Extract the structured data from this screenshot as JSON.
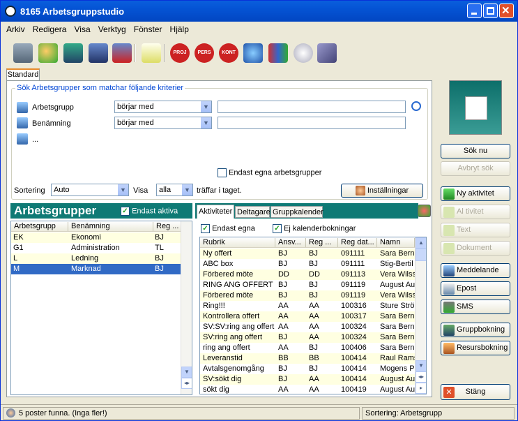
{
  "window": {
    "title": "8165 Arbetsgruppstudio"
  },
  "menu": [
    "Arkiv",
    "Redigera",
    "Visa",
    "Verktyg",
    "Fönster",
    "Hjälp"
  ],
  "toolbar": {
    "icons": [
      "copy-icon",
      "add-user-icon",
      "add-group-icon",
      "save-icon",
      "delete-icon",
      "checklist-icon",
      "proj-icon",
      "pers-icon",
      "kont-icon",
      "sync-icon",
      "books-icon",
      "stopwatch-icon",
      "notebook-icon"
    ],
    "labels": {
      "proj": "PROJ",
      "pers": "PERS",
      "kont": "KONT"
    }
  },
  "tab": "Standard",
  "search": {
    "legend": "Sök  Arbetsgrupper som matchar följande kriterier",
    "rows": [
      {
        "label": "Arbetsgrupp",
        "operator": "börjar med",
        "value": ""
      },
      {
        "label": "Benämning",
        "operator": "börjar med",
        "value": ""
      }
    ],
    "more": "...",
    "own_only": "Endast egna arbetsgrupper",
    "sort_label": "Sortering",
    "sort_value": "Auto",
    "show_label": "Visa",
    "show_value": "alla",
    "hits_suffix": "träffar i taget.",
    "settings_button": "Inställningar"
  },
  "groups": {
    "title": "Arbetsgrupper",
    "active_only": "Endast aktiva",
    "columns": [
      "Arbetsgrupp",
      "Benämning",
      "Reg ..."
    ],
    "rows": [
      {
        "code": "EK",
        "name": "Ekonomi",
        "reg": "BJ"
      },
      {
        "code": "G1",
        "name": "Administration",
        "reg": "TL"
      },
      {
        "code": "L",
        "name": "Ledning",
        "reg": "BJ"
      },
      {
        "code": "M",
        "name": "Marknad",
        "reg": "BJ"
      }
    ],
    "selected": 3
  },
  "activities": {
    "tabs": [
      "Aktiviteter",
      "Deltagare",
      "Gruppkalender"
    ],
    "own_only": "Endast egna",
    "no_calendar": "Ej kalenderbokningar",
    "columns": [
      "Rubrik",
      "Ansv...",
      "Reg ...",
      "Reg dat...",
      "Namn"
    ],
    "rows": [
      [
        "Ny offert",
        "BJ",
        "BJ",
        "091111",
        "Sara Bernh"
      ],
      [
        "ABC box",
        "BJ",
        "BJ",
        "091111",
        "Stig-Bertil A"
      ],
      [
        "Förbered möte",
        "DD",
        "DD",
        "091113",
        "Vera Wilss"
      ],
      [
        "RING ANG OFFERT",
        "BJ",
        "BJ",
        "091119",
        "August Au"
      ],
      [
        "Förbered möte",
        "BJ",
        "BJ",
        "091119",
        "Vera Wilss"
      ],
      [
        "Ring!!!",
        "AA",
        "AA",
        "100316",
        "Sture Strör"
      ],
      [
        "Kontrollera offert",
        "AA",
        "AA",
        "100317",
        "Sara Bernh"
      ],
      [
        "SV:SV:ring ang offert",
        "AA",
        "AA",
        "100324",
        "Sara Bernh"
      ],
      [
        "SV:ring ang offert",
        "BJ",
        "AA",
        "100324",
        "Sara Bernh"
      ],
      [
        "ring ang offert",
        "AA",
        "BJ",
        "100406",
        "Sara Bernh"
      ],
      [
        "Leveranstid",
        "BB",
        "BB",
        "100414",
        "Raul Rams"
      ],
      [
        "Avtalsgenomgång",
        "BJ",
        "BJ",
        "100414",
        "Mogens P"
      ],
      [
        "SV:sökt dig",
        "BJ",
        "AA",
        "100414",
        "August Au"
      ],
      [
        "sökt dig",
        "AA",
        "AA",
        "100419",
        "August Au"
      ]
    ]
  },
  "sidebar": {
    "search_now": "Sök nu",
    "cancel_search": "Avbryt sök",
    "new_activity": "Ny aktivitet",
    "to_activity": "Al tivitet",
    "text": "Text",
    "document": "Dokument",
    "message": "Meddelande",
    "email": "Epost",
    "sms": "SMS",
    "group_booking": "Gruppbokning",
    "resource_booking": "Resursbokning",
    "close": "Stäng"
  },
  "status": {
    "left": "5 poster funna. (Inga fler!)",
    "right": "Sortering: Arbetsgrupp"
  }
}
